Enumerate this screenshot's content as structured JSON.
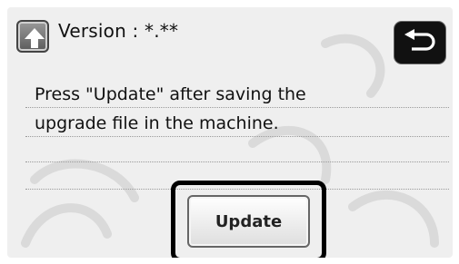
{
  "header": {
    "version_text": "Version : *.**",
    "up_icon": "up-arrow-icon",
    "back_icon": "return-arrow-icon"
  },
  "message": {
    "text": "Press \"Update\" after saving the\nupgrade  file in the machine."
  },
  "actions": {
    "update_label": "Update"
  },
  "colors": {
    "screen_bg": "#efefef",
    "button_dark": "#111111",
    "frame": "#000000"
  }
}
